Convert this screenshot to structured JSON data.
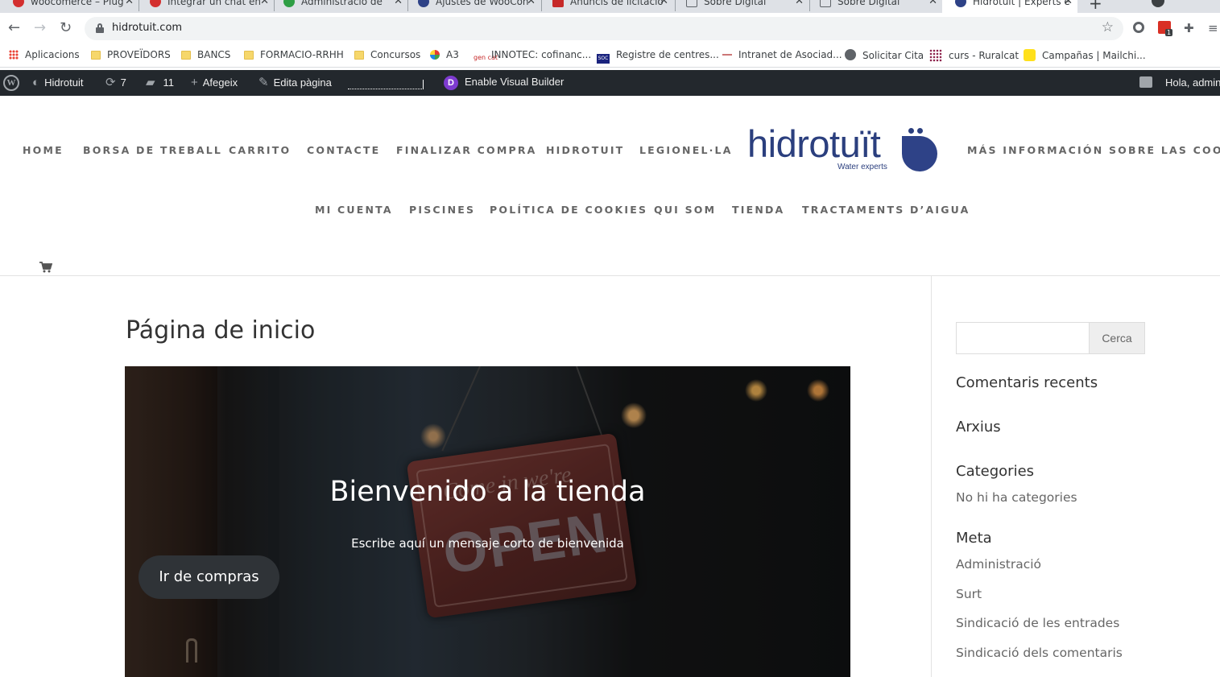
{
  "browser": {
    "tabs": [
      {
        "title": "woocomerce – Plug",
        "color": "#d32f2f",
        "glyph": "W"
      },
      {
        "title": "Integrar un chat en",
        "color": "#d32f2f",
        "glyph": "W"
      },
      {
        "title": "Administració de",
        "color": "#2e9e44",
        "glyph": "W"
      },
      {
        "title": "Ajustes de WooCon",
        "color": "#2e4287",
        "glyph": ""
      },
      {
        "title": "Anuncis de licitació",
        "color": "#c62828",
        "glyph": "cat"
      },
      {
        "title": "Sobre Digital",
        "color": "#5f6368",
        "glyph": "mail"
      },
      {
        "title": "Sobre Digital",
        "color": "#5f6368",
        "glyph": "mail"
      },
      {
        "title": "Hidrotuït | Experts e",
        "color": "#2e4287",
        "glyph": ""
      }
    ],
    "url": "hidrotuit.com",
    "bookmarks": [
      {
        "label": "Aplicacions",
        "icon": "apps-grid-icon"
      },
      {
        "label": "PROVEÏDORS",
        "icon": "folder-icon"
      },
      {
        "label": "BANCS",
        "icon": "folder-icon"
      },
      {
        "label": "FORMACIO-RRHH",
        "icon": "folder-icon"
      },
      {
        "label": "Concursos",
        "icon": "folder-icon"
      },
      {
        "label": "A3",
        "icon": "a3-icon"
      },
      {
        "label": "INNOTEC: cofinanc...",
        "icon": "gencat-icon"
      },
      {
        "label": "Registre de centres...",
        "icon": "soc-icon"
      },
      {
        "label": "Intranet de Asociad...",
        "icon": "dash-icon"
      },
      {
        "label": "Solicitar Cita",
        "icon": "globe-icon"
      },
      {
        "label": "curs - Ruralcat",
        "icon": "grid-icon"
      },
      {
        "label": "Campañas | Mailchi...",
        "icon": "mailchimp-icon"
      }
    ],
    "extension_badge": "1"
  },
  "adminbar": {
    "site_name": "Hidrotuit",
    "updates": "7",
    "comments": "11",
    "new_label": "Afegeix",
    "edit_label": "Edita pàgina",
    "visual_builder": "Enable Visual Builder",
    "greeting": "Hola, admin"
  },
  "nav": {
    "row1": [
      "HOME",
      "BORSA DE TREBALL",
      "CARRITO",
      "CONTACTE",
      "FINALIZAR COMPRA",
      "HIDROTUIT",
      "LEGIONEL·LA"
    ],
    "row1_right": "MÁS INFORMACIÓN SOBRE LAS COOKIES",
    "row2": [
      "MI CUENTA",
      "PISCINES",
      "POLÍTICA DE COOKIES",
      "QUI SOM",
      "TIENDA",
      "TRACTAMENTS D’AIGUA"
    ]
  },
  "logo": {
    "name": "hidrotuït",
    "tagline": "Water experts",
    "color": "#2b3f7e"
  },
  "page": {
    "title": "Página de inicio",
    "hero_title": "Bienvenido a la tienda",
    "hero_subtitle": "Escribe aquí un mensaje corto de bienvenida",
    "hero_button": "Ir de compras",
    "sign_text": "OPEN",
    "sign_small": "Come in we're"
  },
  "sidebar": {
    "search_button": "Cerca",
    "recent_comments": "Comentaris recents",
    "archives": "Arxius",
    "categories": "Categories",
    "no_categories": "No hi ha categories",
    "meta": "Meta",
    "meta_links": [
      "Administració",
      "Surt",
      "Sindicació de les entrades",
      "Sindicació dels comentaris"
    ]
  }
}
